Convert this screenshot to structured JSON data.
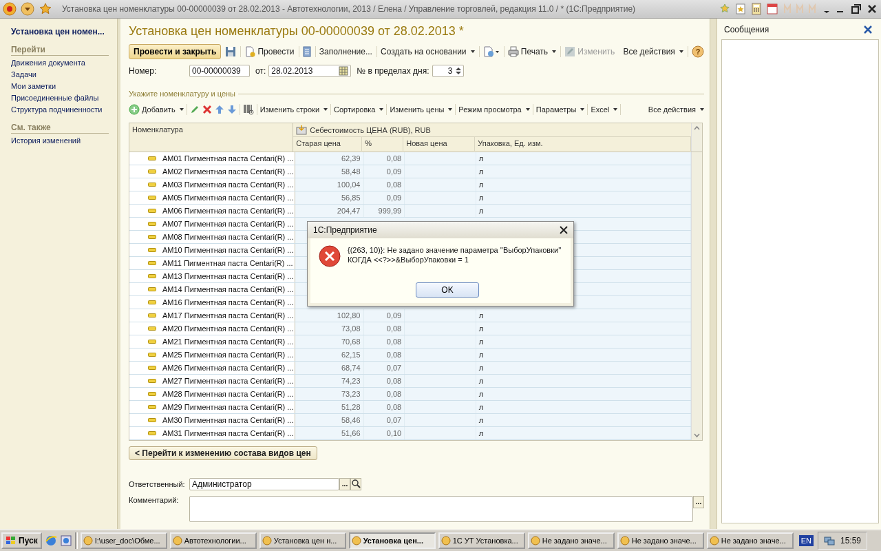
{
  "window": {
    "title": "Установка цен номенклатуры 00-00000039 от 28.02.2013 - Автотехнологии, 2013 / Елена / Управление торговлей, редакция 11.0 / * (1С:Предприятие)"
  },
  "sidebar": {
    "title": "Установка цен номен...",
    "sections": [
      {
        "heading": "Перейти",
        "items": [
          "Движения документа",
          "Задачи",
          "Мои заметки",
          "Присоединенные файлы",
          "Структура подчиненности"
        ]
      },
      {
        "heading": "См. также",
        "items": [
          "История изменений"
        ]
      }
    ]
  },
  "document": {
    "title": "Установка цен номенклатуры 00-00000039 от 28.02.2013 *",
    "toolbar": {
      "post_and_close": "Провести и закрыть",
      "post": "Провести",
      "fill": "Заполнение...",
      "create_based_on": "Создать на основании",
      "print": "Печать",
      "edit": {
        "label": "Изменить",
        "disabled": true
      },
      "all_actions": "Все действия",
      "help": "?"
    },
    "number": {
      "label": "Номер:",
      "value": "00-00000039"
    },
    "date": {
      "label": "от:",
      "value": "28.02.2013"
    },
    "day_number": {
      "label": "№ в пределах дня:",
      "value": "3"
    },
    "section_title": "Укажите номенклатуру и цены",
    "table_toolbar": {
      "add": "Добавить",
      "menus": [
        "Изменить строки",
        "Сортировка",
        "Изменить цены",
        "Режим просмотра",
        "Параметры",
        "Excel",
        "Все действия"
      ]
    },
    "table": {
      "columns": {
        "nomenclature": "Номенклатура",
        "group": "Себестоимость ЦЕНА (RUB), RUB",
        "sub": [
          "Старая цена",
          "%",
          "Новая цена",
          "Упаковка, Ед. изм."
        ]
      },
      "rows": [
        {
          "name": "AM01 Пигментная паста Centari(R) ...",
          "old_price": "62,39",
          "percent": "0,08",
          "unit": "л"
        },
        {
          "name": "AM02 Пигментная паста Centari(R) ...",
          "old_price": "58,48",
          "percent": "0,09",
          "unit": "л"
        },
        {
          "name": "AM03 Пигментная паста Centari(R) ...",
          "old_price": "100,04",
          "percent": "0,08",
          "unit": "л"
        },
        {
          "name": "AM05 Пигментная паста Centari(R) ...",
          "old_price": "56,85",
          "percent": "0,09",
          "unit": "л"
        },
        {
          "name": "AM06 Пигментная паста Centari(R) ...",
          "old_price": "204,47",
          "percent": "999,99",
          "unit": "л"
        },
        {
          "name": "AM07 Пигментная паста Centari(R) ..."
        },
        {
          "name": "AM08 Пигментная паста Centari(R) ..."
        },
        {
          "name": "AM10 Пигментная паста Centari(R) ..."
        },
        {
          "name": "AM11 Пигментная паста Centari(R) ..."
        },
        {
          "name": "AM13 Пигментная паста Centari(R) ..."
        },
        {
          "name": "AM14 Пигментная паста Centari(R) ..."
        },
        {
          "name": "AM16 Пигментная паста Centari(R) ..."
        },
        {
          "name": "AM17 Пигментная паста Centari(R) ...",
          "old_price": "102,80",
          "percent": "0,09",
          "unit": "л"
        },
        {
          "name": "AM20 Пигментная паста Centari(R) ...",
          "old_price": "73,08",
          "percent": "0,08",
          "unit": "л"
        },
        {
          "name": "AM21 Пигментная паста Centari(R) ...",
          "old_price": "70,68",
          "percent": "0,08",
          "unit": "л"
        },
        {
          "name": "AM25 Пигментная паста Centari(R) ...",
          "old_price": "62,15",
          "percent": "0,08",
          "unit": "л"
        },
        {
          "name": "AM26 Пигментная паста Centari(R) ...",
          "old_price": "68,74",
          "percent": "0,07",
          "unit": "л"
        },
        {
          "name": "AM27 Пигментная паста Centari(R) ...",
          "old_price": "74,23",
          "percent": "0,08",
          "unit": "л"
        },
        {
          "name": "AM28 Пигментная паста Centari(R) ...",
          "old_price": "73,23",
          "percent": "0,08",
          "unit": "л"
        },
        {
          "name": "AM29 Пигментная паста Centari(R) ...",
          "old_price": "51,28",
          "percent": "0,08",
          "unit": "л"
        },
        {
          "name": "AM30 Пигментная паста Centari(R) ...",
          "old_price": "58,46",
          "percent": "0,07",
          "unit": "л"
        },
        {
          "name": "AM31 Пигментная паста Centari(R) ...",
          "old_price": "51,66",
          "percent": "0,10",
          "unit": "л"
        }
      ]
    },
    "back_button": "< Перейти к изменению состава видов цен",
    "responsible": {
      "label": "Ответственный:",
      "value": "Администратор",
      "select": "..."
    },
    "comment": {
      "label": "Комментарий:",
      "select": "..."
    }
  },
  "messages": {
    "title": "Сообщения"
  },
  "dialog": {
    "title": "1С:Предприятие",
    "lines": [
      "{(263, 10)}: Не задано значение параметра ''ВыборУпаковки''",
      "КОГДА <<?>>&ВыборУпаковки = 1"
    ],
    "button": "OK"
  },
  "taskbar": {
    "start": "Пуск",
    "items": [
      {
        "label": "I:\\user_doc\\Обме...",
        "selected": false
      },
      {
        "label": "Автотехнологии...",
        "selected": false
      },
      {
        "label": "Установка цен н...",
        "selected": false
      },
      {
        "label": "Установка цен...",
        "selected": true
      },
      {
        "label": "1С УТ Установка...",
        "selected": false
      },
      {
        "label": "Не задано значе...",
        "selected": false
      },
      {
        "label": "Не задано значе...",
        "selected": false
      },
      {
        "label": "Не задано значе...",
        "selected": false
      }
    ],
    "language": "EN",
    "clock": "15:59"
  }
}
